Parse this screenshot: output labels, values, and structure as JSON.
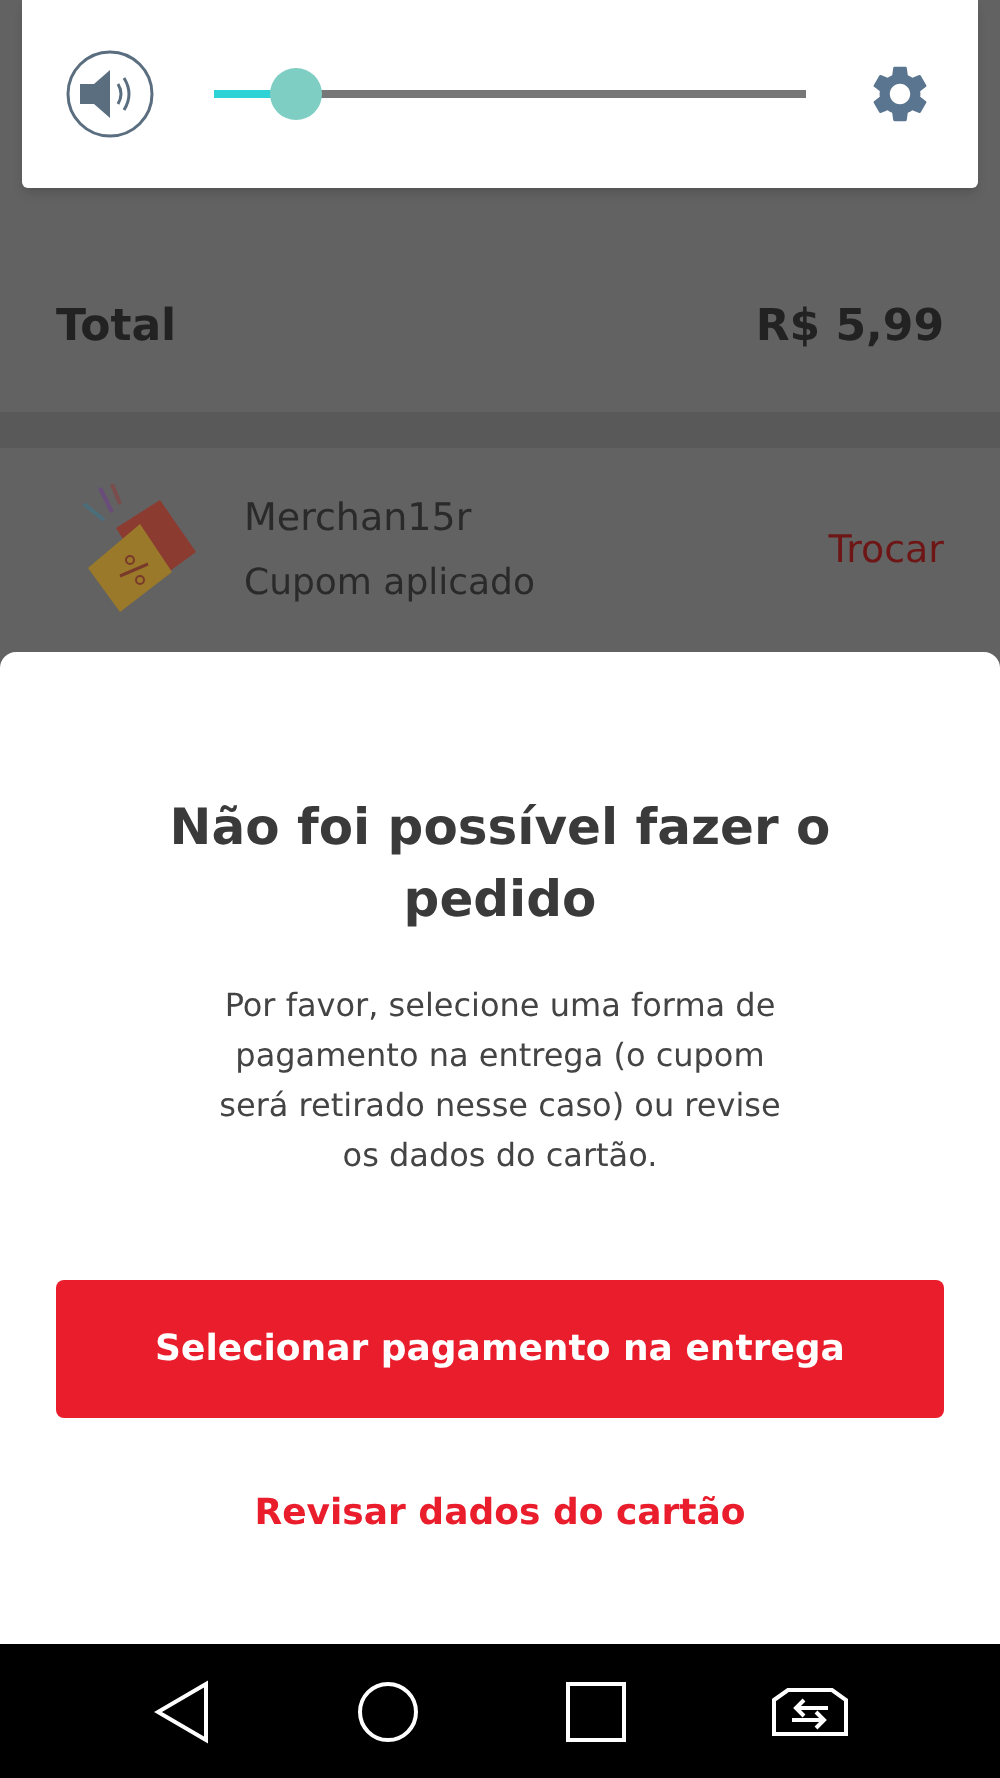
{
  "volume_panel": {
    "level": 0.14
  },
  "order_summary": {
    "total_label": "Total",
    "total_value": "R$ 5,99"
  },
  "coupon": {
    "code": "Merchan15r",
    "status": "Cupom aplicado",
    "action": "Trocar"
  },
  "dialog": {
    "title": "Não foi possível fazer o pedido",
    "message": "Por favor, selecione uma forma de pagamento na entrega (o cupom será retirado nesse caso) ou revise os dados do cartão.",
    "primary_button": "Selecionar pagamento na entrega",
    "secondary_button": "Revisar dados do cartão"
  }
}
